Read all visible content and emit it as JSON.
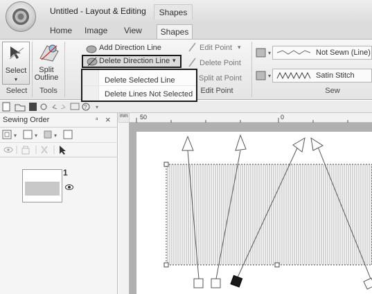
{
  "window": {
    "title": "Untitled - Layout & Editing",
    "context_tab": "Shapes"
  },
  "tabs": [
    "Home",
    "Image",
    "View",
    "Shapes"
  ],
  "ribbon": {
    "select": {
      "label": "Select",
      "group": "Select"
    },
    "split_outline": {
      "label": "Split Outline",
      "group": "Tools"
    },
    "add_direction_line": "Add Direction Line",
    "delete_direction_line": "Delete Direction Line",
    "edit_point": "Edit Point",
    "delete_point": "Delete Point",
    "split_at_point": "Split at Point",
    "edit_point_group": "Edit Point",
    "sew": {
      "line_style": "Not Sewn (Line)",
      "region_style": "Satin Stitch",
      "group": "Sew"
    }
  },
  "dropdown_menu": {
    "items": [
      "Delete Selected Line",
      "Delete Lines Not Selected"
    ]
  },
  "sewing_order_panel": {
    "title": "Sewing Order",
    "pin": "ᵃ",
    "close": "×",
    "item_number": "1"
  },
  "rulers": {
    "unit": "mm",
    "h_label_left": "50",
    "h_label_right": "0"
  },
  "icons": {
    "app": "app-menu-icon",
    "select": "select-arrow-icon",
    "split_outline": "split-outline-icon"
  },
  "colors": {
    "highlight_border": "#1a1a1a",
    "stitch_fill": "#c9c9c9"
  }
}
